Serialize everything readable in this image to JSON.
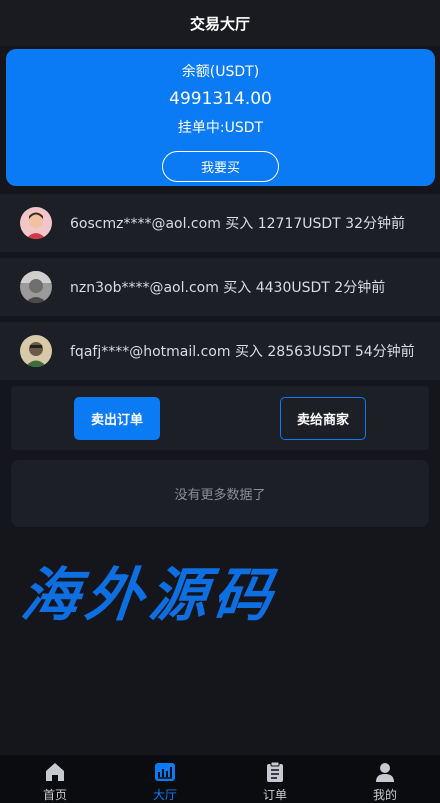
{
  "header": {
    "title": "交易大厅"
  },
  "balance": {
    "label": "余额(USDT)",
    "value": "4991314.00",
    "pending": "挂单中:USDT",
    "buy_button": "我要买"
  },
  "trades": [
    {
      "text": "6oscmz****@aol.com 买入 12717USDT 32分钟前"
    },
    {
      "text": "nzn3ob****@aol.com 买入 4430USDT 2分钟前"
    },
    {
      "text": "fqafj****@hotmail.com 买入 28563USDT 54分钟前"
    }
  ],
  "actions": {
    "sell_order": "卖出订单",
    "sell_merchant": "卖给商家"
  },
  "empty": {
    "text": "没有更多数据了"
  },
  "watermark": {
    "text": "海外源码"
  },
  "tabbar": {
    "items": [
      {
        "label": "首页",
        "icon": "home-icon"
      },
      {
        "label": "大厅",
        "icon": "chart-icon",
        "active": true
      },
      {
        "label": "订单",
        "icon": "clipboard-icon"
      },
      {
        "label": "我的",
        "icon": "user-icon"
      }
    ]
  },
  "colors": {
    "accent": "#0a7bf5",
    "background": "#14161b",
    "card": "#1c1f25"
  }
}
